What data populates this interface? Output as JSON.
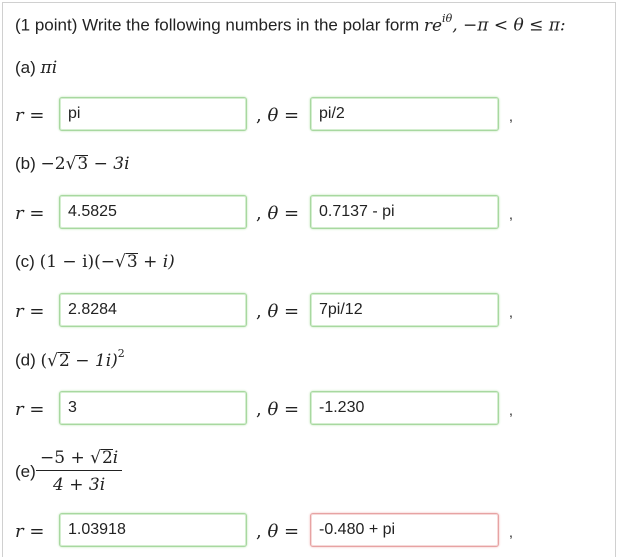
{
  "problem": {
    "points": "(1 point)",
    "instruction": "Write the following numbers in the polar form",
    "form": "re",
    "form_sup": "iθ",
    "range": ", −π < θ ≤ π:"
  },
  "parts": [
    {
      "label": "(a)",
      "expr": "πi",
      "r_value": "pi",
      "theta_value": "pi/2",
      "theta_state": "correct"
    },
    {
      "label": "(b)",
      "expr_pre": "−2",
      "expr_sqrt": "3",
      "expr_post": " − 3i",
      "r_value": "4.5825",
      "theta_value": "0.7137 - pi",
      "theta_state": "correct"
    },
    {
      "label": "(c)",
      "expr_pre": "(1 − i)(−",
      "expr_sqrt": "3",
      "expr_post": " + i)",
      "r_value": "2.8284",
      "theta_value": "7pi/12",
      "theta_state": "correct"
    },
    {
      "label": "(d)",
      "expr_pre": "(",
      "expr_sqrt": "2",
      "expr_post": " − 1i)",
      "expr_sup": "2",
      "r_value": "3",
      "theta_value": "-1.230",
      "theta_state": "correct"
    },
    {
      "label": "(e)",
      "num_pre": "−5 + ",
      "num_sqrt": "2",
      "num_post": "i",
      "den": "4 + 3i",
      "r_value": "1.03918",
      "theta_value": "-0.480 + pi",
      "theta_state": "wrong"
    }
  ],
  "labels": {
    "r": "r",
    "theta": "θ",
    "eq": " = ",
    "comma_theta": ",",
    "trailing_comma": ","
  },
  "colors": {
    "correct_border": "#a8d8a0",
    "wrong_border": "#e7a3a3"
  }
}
